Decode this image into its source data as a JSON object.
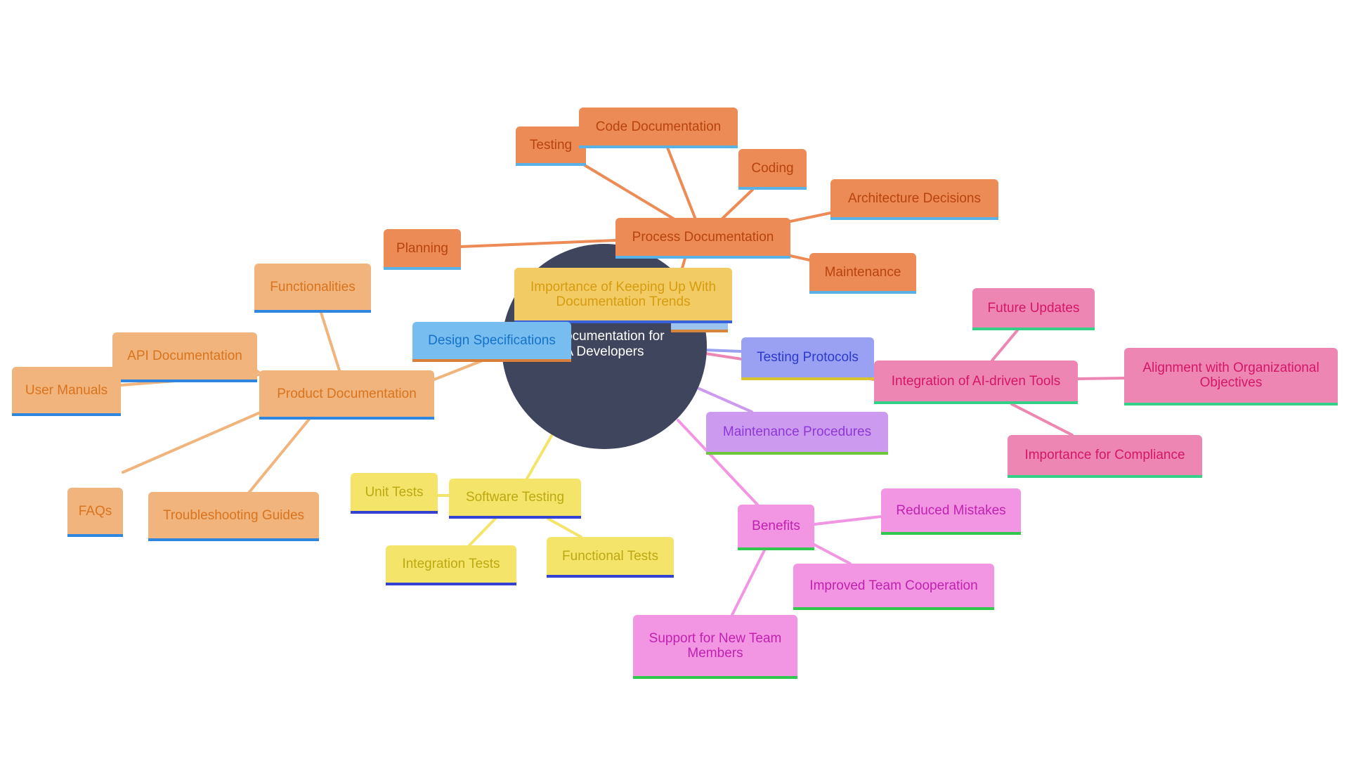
{
  "diagram": {
    "type": "mind-map",
    "center": {
      "label": "Documentation for QA Developers",
      "visible_line_1": "n Documentation for",
      "visible_line_2": "A Developers"
    },
    "colors": {
      "center": "#40455e",
      "process": "#ec8b55",
      "product": "#f1b47c",
      "testing": "#f4e56a",
      "trends": "#f2cb64",
      "design": "#78bdf0",
      "protocols": "#9aa0f2",
      "maintenance_proc": "#cc9bf0",
      "ai_tools": "#ed86b3",
      "benefits": "#f295e2"
    },
    "branches": {
      "process": {
        "label": "Process Documentation",
        "children": [
          "Testing",
          "Code Documentation",
          "Coding",
          "Architecture Decisions",
          "Maintenance",
          "Planning"
        ]
      },
      "product": {
        "label": "Product Documentation",
        "children": [
          "Functionalities",
          "API Documentation",
          "User Manuals",
          "FAQs",
          "Troubleshooting Guides"
        ]
      },
      "testing": {
        "label": "Software Testing",
        "children": [
          "Unit Tests",
          "Integration Tests",
          "Functional Tests"
        ]
      },
      "trends": {
        "label": "Importance of Keeping Up With Documentation Trends"
      },
      "design": {
        "label": "Design Specifications"
      },
      "protocols": {
        "label": "Testing Protocols"
      },
      "maintenance_proc": {
        "label": "Maintenance Procedures"
      },
      "ai_tools": {
        "label": "Integration of AI-driven Tools",
        "children": [
          "Future Updates",
          "Alignment with Organizational Objectives",
          "Importance for Compliance"
        ]
      },
      "benefits": {
        "label": "Benefits",
        "children": [
          "Reduced Mistakes",
          "Improved Team Cooperation",
          "Support for New Team Members"
        ]
      }
    }
  }
}
